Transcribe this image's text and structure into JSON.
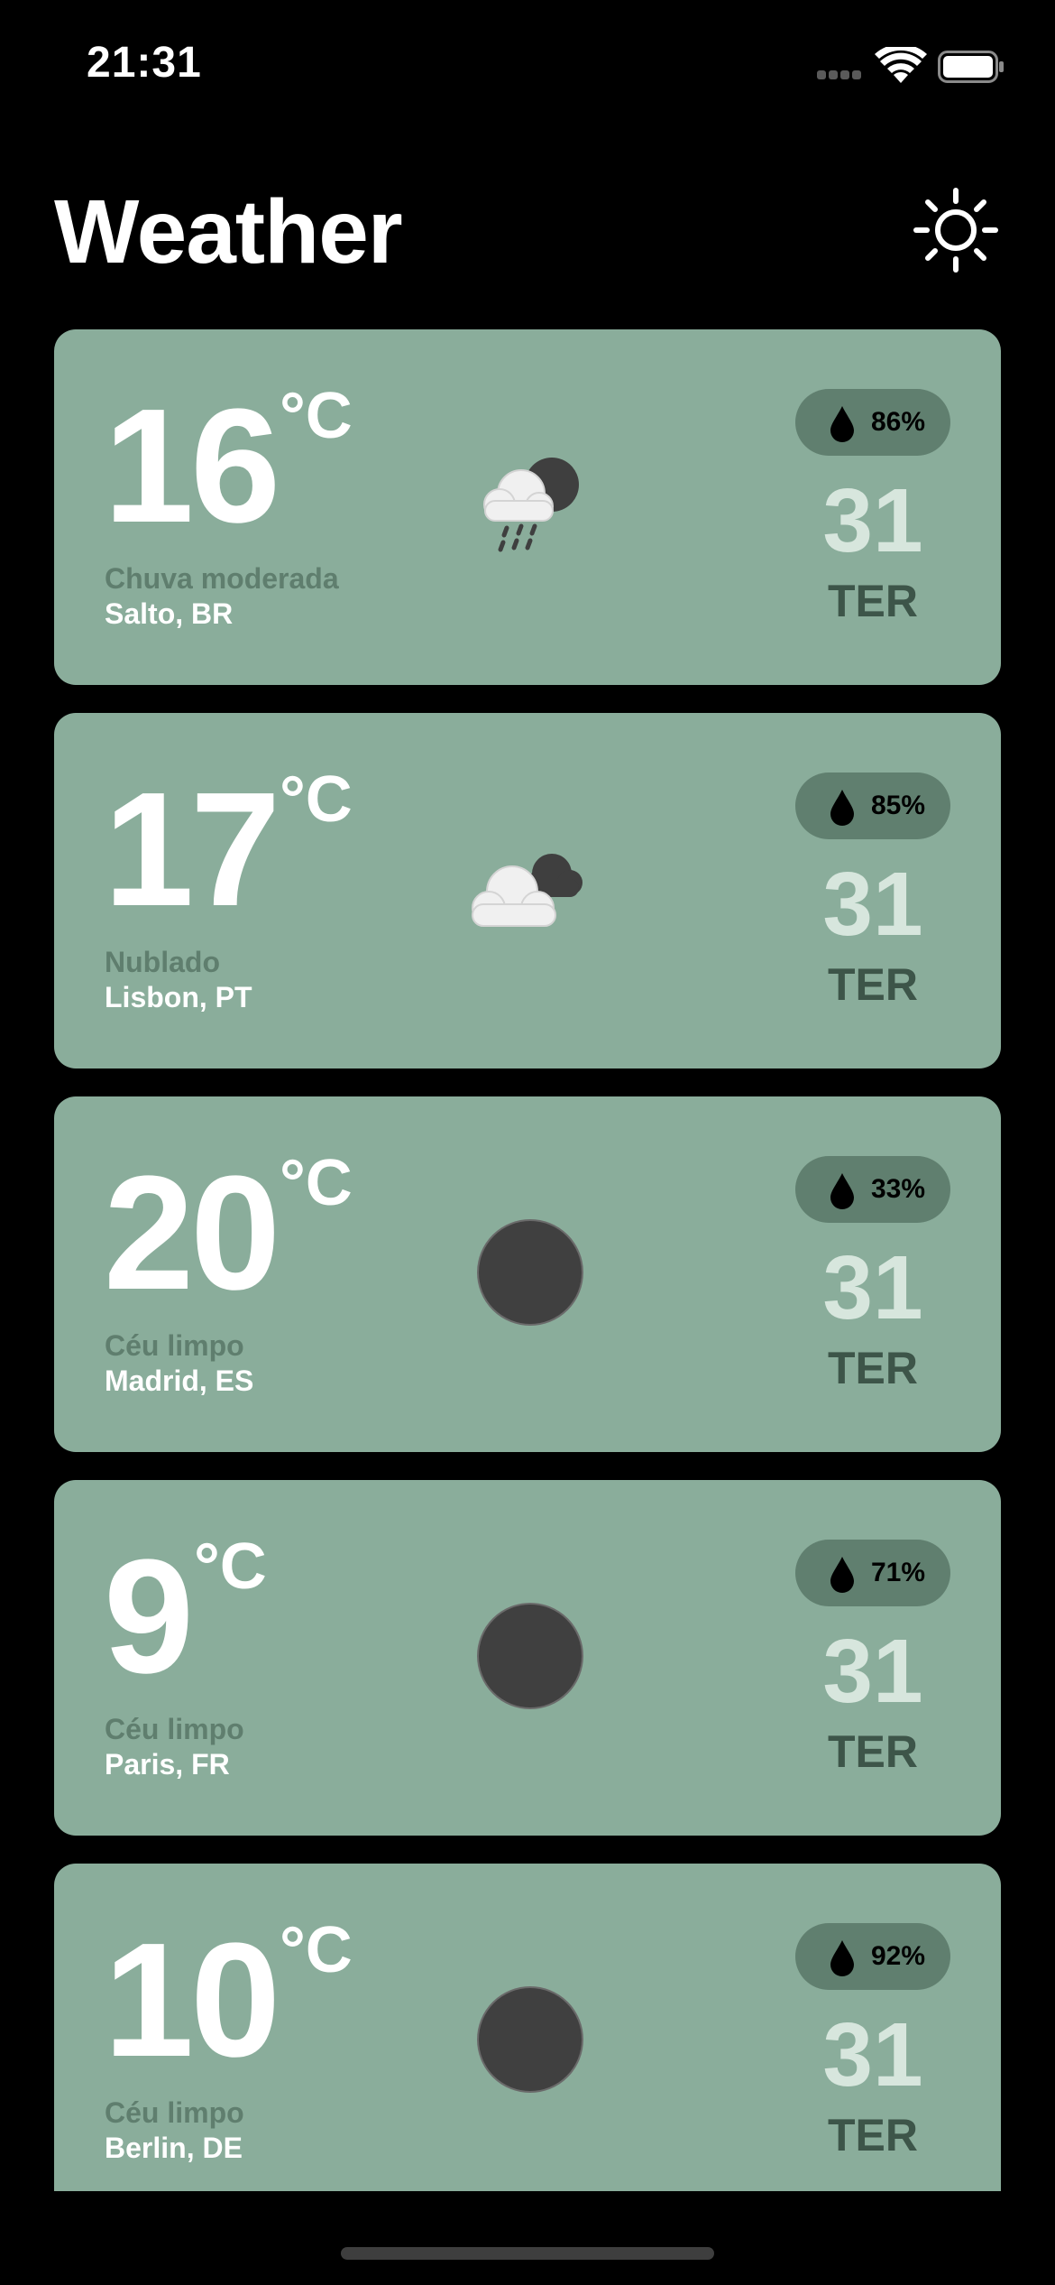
{
  "status_bar": {
    "time": "21:31"
  },
  "header": {
    "title": "Weather",
    "theme_icon": "sun-icon"
  },
  "cards": [
    {
      "temp": "16",
      "unit": "°C",
      "condition": "Chuva moderada",
      "city": "Salto, BR",
      "humidity": "86%",
      "day_num": "31",
      "day_name": "TER",
      "icon": "rain-cloud-icon"
    },
    {
      "temp": "17",
      "unit": "°C",
      "condition": "Nublado",
      "city": "Lisbon, PT",
      "humidity": "85%",
      "day_num": "31",
      "day_name": "TER",
      "icon": "cloudy-icon"
    },
    {
      "temp": "20",
      "unit": "°C",
      "condition": "Céu limpo",
      "city": "Madrid, ES",
      "humidity": "33%",
      "day_num": "31",
      "day_name": "TER",
      "icon": "clear-night-icon"
    },
    {
      "temp": "9",
      "unit": "°C",
      "condition": "Céu limpo",
      "city": "Paris, FR",
      "humidity": "71%",
      "day_num": "31",
      "day_name": "TER",
      "icon": "clear-night-icon"
    },
    {
      "temp": "10",
      "unit": "°C",
      "condition": "Céu limpo",
      "city": "Berlin, DE",
      "humidity": "92%",
      "day_num": "31",
      "day_name": "TER",
      "icon": "clear-night-icon"
    }
  ],
  "colors": {
    "card": "#8aad9b",
    "pill": "#607f6f",
    "condition_text": "#5f7e6e",
    "day_num": "#d7e6dd",
    "day_name": "#3d5549"
  }
}
